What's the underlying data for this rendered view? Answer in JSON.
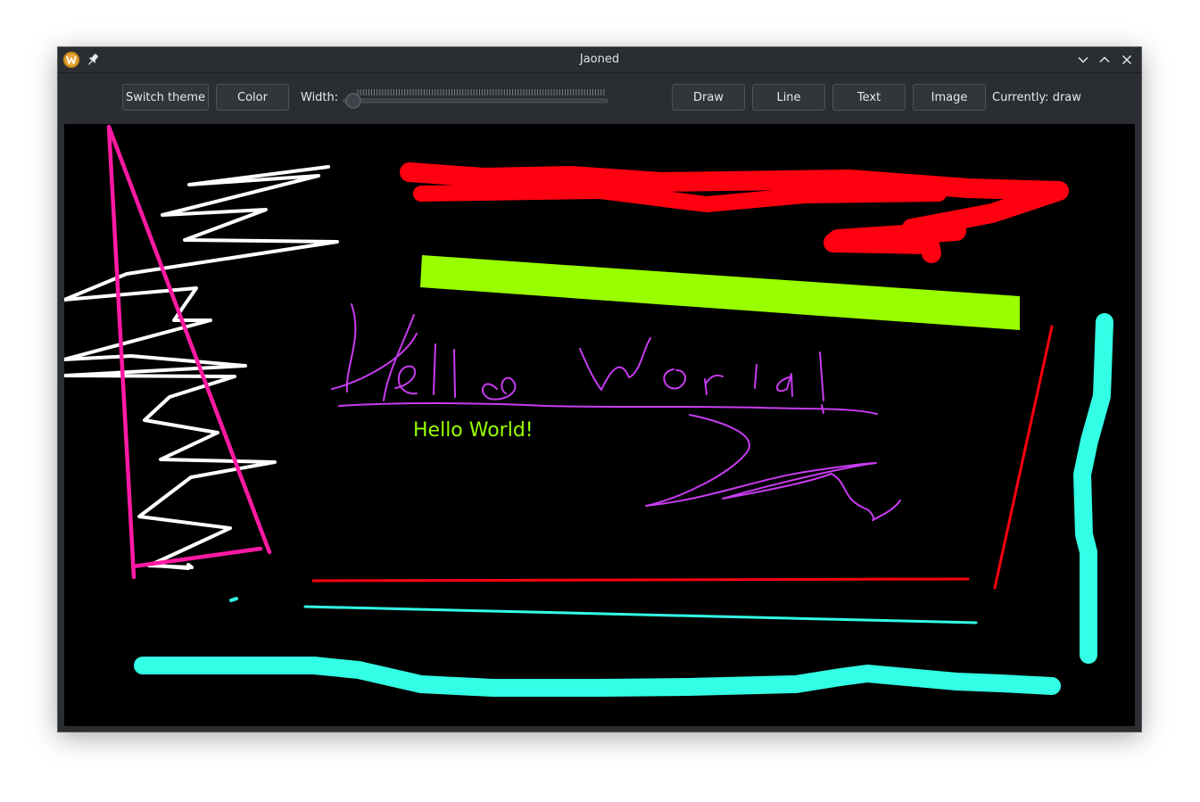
{
  "window": {
    "title": "Jaoned",
    "app_icon": "app-logo-icon",
    "controls": [
      "minimize-icon",
      "maximize-icon",
      "close-icon"
    ]
  },
  "toolbar": {
    "switch_theme_label": "Switch theme",
    "color_label": "Color",
    "width_label": "Width:",
    "width_value": 0,
    "draw_label": "Draw",
    "line_label": "Line",
    "text_label": "Text",
    "image_label": "Image",
    "status": "Currently: draw"
  },
  "canvas": {
    "background": "#000000",
    "text_item": "Hello World!",
    "text_color": "#99ff00",
    "stroke_colors": {
      "pink": "#ff1aa3",
      "white": "#ffffff",
      "red": "#ff0010",
      "lime": "#99ff00",
      "purple": "#c83cf0",
      "cyan": "#33ffe6"
    }
  }
}
